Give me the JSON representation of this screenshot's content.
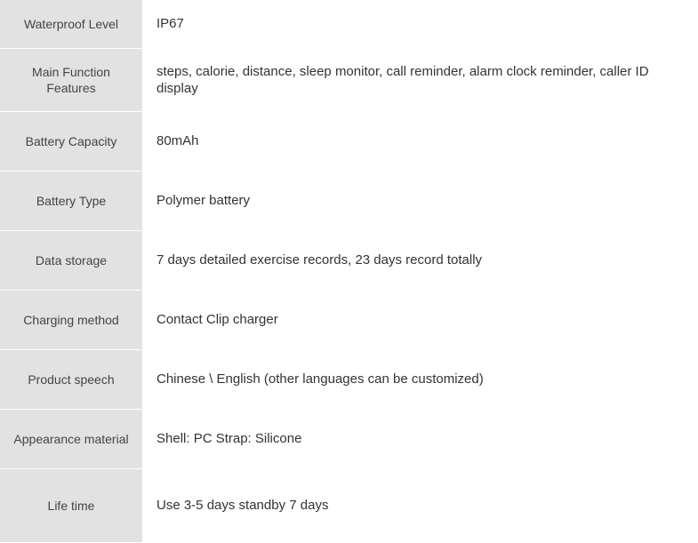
{
  "spec_rows": [
    {
      "label": "Waterproof Level",
      "value": "IP67"
    },
    {
      "label": "Main Function Features",
      "value": "steps, calorie, distance, sleep monitor, call reminder, alarm clock reminder, caller ID display"
    },
    {
      "label": "Battery Capacity",
      "value": "80mAh"
    },
    {
      "label": "Battery Type",
      "value": "Polymer battery"
    },
    {
      "label": "Data storage",
      "value": "7 days detailed exercise records, 23 days record totally"
    },
    {
      "label": "Charging method",
      "value": "Contact Clip charger"
    },
    {
      "label": "Product speech",
      "value": "Chinese \\ English  (other languages can be customized)"
    },
    {
      "label": "Appearance material",
      "value": "Shell: PC      Strap: Silicone"
    },
    {
      "label": "Life time",
      "value": "Use 3-5 days   standby 7 days"
    }
  ]
}
